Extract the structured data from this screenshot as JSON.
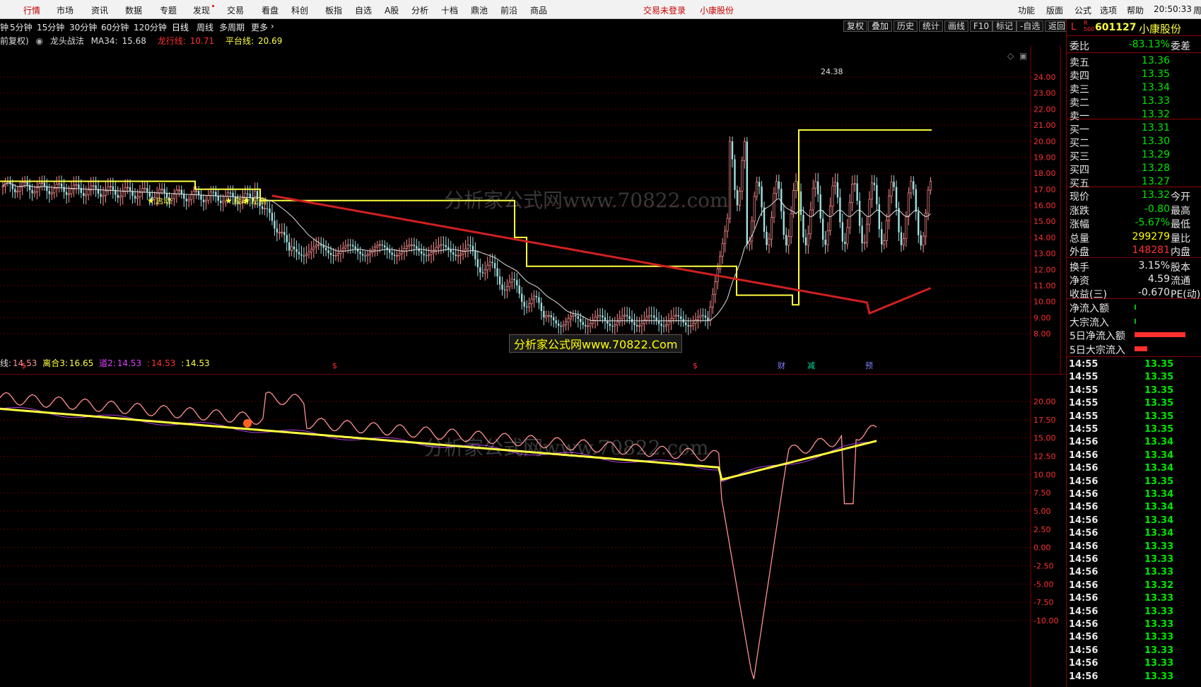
{
  "menu": {
    "items": [
      "行情",
      "市场",
      "资讯",
      "数据",
      "专题",
      "发现",
      "交易",
      "看盘",
      "科创",
      "板指",
      "自选",
      "A股",
      "分析",
      "十档",
      "鼎池",
      "前沿",
      "商品"
    ],
    "status": [
      "交易未登录",
      "小康股份"
    ],
    "right": [
      "功能",
      "版面",
      "公式",
      "选项",
      "帮助"
    ],
    "time": "20:50:33",
    "tail": "周"
  },
  "periods": {
    "items": [
      "5分钟",
      "15分钟",
      "30分钟",
      "60分钟",
      "120分钟",
      "日线",
      "周线",
      "多周期",
      "更多"
    ],
    "selected": "日线",
    "lead": "钟"
  },
  "toolbar": [
    "复权",
    "叠加",
    "历史",
    "统计",
    "画线",
    "F10",
    "标记",
    "-自选",
    "返回"
  ],
  "indicator_main": {
    "prefix": "前复权)",
    "name": "龙头战法",
    "ma34_label": "MA34:",
    "ma34": "15.68",
    "dragon_label": "龙行线:",
    "dragon": "10.71",
    "platform_label": "平台线:",
    "platform": "20.69"
  },
  "indicator_sub": {
    "line_label": "线:",
    "line": "14.53",
    "leave_label": "离合3:",
    "leave": "16.65",
    "road_label": "道2:",
    "road": "14.53",
    "v4_label": ":",
    "v4": "14.53",
    "v5_label": ":",
    "v5": "14.53"
  },
  "main_chart": {
    "price_axis": [
      "24.00",
      "23.00",
      "22.00",
      "21.00",
      "20.00",
      "19.00",
      "18.00",
      "17.00",
      "16.00",
      "15.00",
      "14.00",
      "13.00",
      "12.00",
      "11.00",
      "10.00",
      "9.00",
      "8.00"
    ],
    "high_label": "24.38",
    "signals": [
      "启动",
      "启动",
      "左侧"
    ],
    "bottom_marks": [
      "财",
      "减",
      "预"
    ],
    "colors": {
      "platform": "#ffff40",
      "ma": "#e0e0e0",
      "longma": "#d02020",
      "candle_up": "#ff3030",
      "candle_down": "#00d0d0"
    }
  },
  "sub_chart": {
    "axis": [
      "20.00",
      "17.50",
      "15.00",
      "12.50",
      "10.00",
      "7.50",
      "5.00",
      "2.50",
      "0.00",
      "-2.50",
      "-5.00",
      "-7.50",
      "-10.00"
    ]
  },
  "watermarks": {
    "top": "分析家公式网www.70822.com",
    "box": "分析家公式网www.70822.Com",
    "sub": "分析家公式网www.70822.com"
  },
  "stock": {
    "prefix": "L",
    "code": "601127",
    "name": "小康股份",
    "weibi_label": "委比",
    "weibi": "-83.13%",
    "weicha_label": "委差",
    "asks": [
      {
        "label": "卖五",
        "price": "13.36"
      },
      {
        "label": "卖四",
        "price": "13.35"
      },
      {
        "label": "卖三",
        "price": "13.34"
      },
      {
        "label": "卖二",
        "price": "13.33"
      },
      {
        "label": "卖一",
        "price": "13.32"
      }
    ],
    "bids": [
      {
        "label": "买一",
        "price": "13.31"
      },
      {
        "label": "买二",
        "price": "13.30"
      },
      {
        "label": "买三",
        "price": "13.29"
      },
      {
        "label": "买四",
        "price": "13.28"
      },
      {
        "label": "买五",
        "price": "13.27"
      }
    ],
    "quote": [
      {
        "label": "现价",
        "value": "13.32",
        "right": "今开",
        "color": "green"
      },
      {
        "label": "涨跌",
        "value": "-0.80",
        "right": "最高",
        "color": "green"
      },
      {
        "label": "涨幅",
        "value": "-5.67%",
        "right": "最低",
        "color": "green"
      },
      {
        "label": "总量",
        "value": "299279",
        "right": "量比",
        "color": "yellow"
      },
      {
        "label": "外盘",
        "value": "148281",
        "right": "内盘",
        "color": "red"
      }
    ],
    "stats": [
      {
        "label": "换手",
        "value": "3.15%",
        "right": "股本",
        "color": "white"
      },
      {
        "label": "净资",
        "value": "4.59",
        "right": "流通",
        "color": "white"
      },
      {
        "label": "收益(三)",
        "value": "-0.670",
        "right": "PE(动)",
        "color": "white"
      }
    ],
    "flows": [
      {
        "label": "净流入额",
        "bar": 0.01
      },
      {
        "label": "大宗流入",
        "bar": 0.01
      },
      {
        "label": "5日净流入额",
        "bar": 1.0
      },
      {
        "label": "5日大宗流入",
        "bar": 0.25
      }
    ]
  },
  "ticks": [
    {
      "time": "14:55",
      "price": "13.35"
    },
    {
      "time": "14:55",
      "price": "13.35"
    },
    {
      "time": "14:55",
      "price": "13.35"
    },
    {
      "time": "14:55",
      "price": "13.35"
    },
    {
      "time": "14:55",
      "price": "13.35"
    },
    {
      "time": "14:55",
      "price": "13.35"
    },
    {
      "time": "14:56",
      "price": "13.34"
    },
    {
      "time": "14:56",
      "price": "13.34"
    },
    {
      "time": "14:56",
      "price": "13.34"
    },
    {
      "time": "14:56",
      "price": "13.35"
    },
    {
      "time": "14:56",
      "price": "13.34"
    },
    {
      "time": "14:56",
      "price": "13.34"
    },
    {
      "time": "14:56",
      "price": "13.34"
    },
    {
      "time": "14:56",
      "price": "13.34"
    },
    {
      "time": "14:56",
      "price": "13.33"
    },
    {
      "time": "14:56",
      "price": "13.33"
    },
    {
      "time": "14:56",
      "price": "13.33"
    },
    {
      "time": "14:56",
      "price": "13.32"
    },
    {
      "time": "14:56",
      "price": "13.33"
    },
    {
      "time": "14:56",
      "price": "13.33"
    },
    {
      "time": "14:56",
      "price": "13.33"
    },
    {
      "time": "14:56",
      "price": "13.33"
    },
    {
      "time": "14:56",
      "price": "13.33"
    },
    {
      "time": "14:56",
      "price": "13.33"
    },
    {
      "time": "14:56",
      "price": "13.33"
    }
  ]
}
